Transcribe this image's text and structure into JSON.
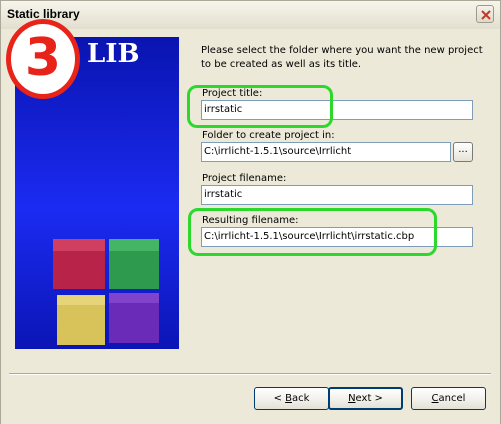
{
  "window": {
    "title": "Static library",
    "close_label": "X"
  },
  "banner": {
    "logo_text": "LIB",
    "step_number": "3"
  },
  "form": {
    "intro": "Please select the folder where you want the new project to be created as well as its title.",
    "project_title": {
      "label": "Project title:",
      "value": "irrstatic"
    },
    "folder": {
      "label": "Folder to create project in:",
      "value": "C:\\irrlicht-1.5.1\\source\\Irrlicht",
      "browse_label": "..."
    },
    "project_filename": {
      "label": "Project filename:",
      "value": "irrstatic"
    },
    "resulting_filename": {
      "label": "Resulting filename:",
      "value": "C:\\irrlicht-1.5.1\\source\\Irrlicht\\irrstatic.cbp"
    }
  },
  "buttons": {
    "back": {
      "prefix": "< ",
      "mnemonic": "B",
      "rest": "ack"
    },
    "next": {
      "mnemonic": "N",
      "rest": "ext >"
    },
    "cancel": {
      "mnemonic": "C",
      "rest": "ancel"
    }
  },
  "colors": {
    "highlight": "#2DD82D",
    "step_badge": "#E8241A",
    "banner": "#1B2BF2"
  }
}
